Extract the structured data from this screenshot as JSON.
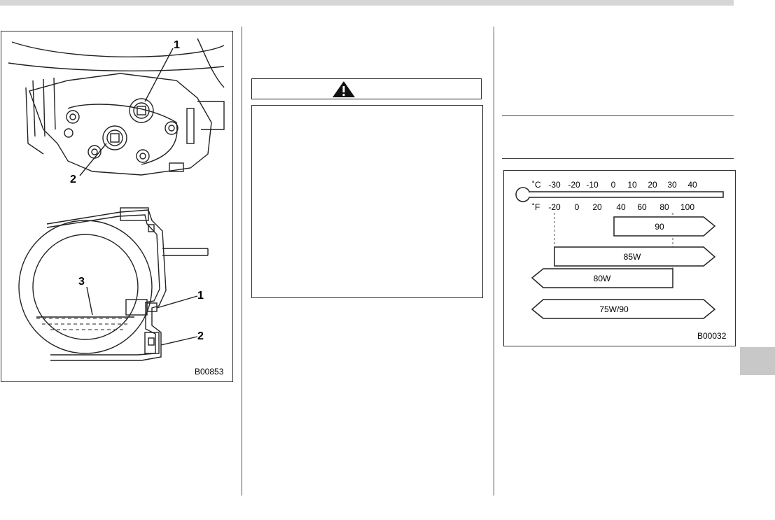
{
  "figure_left": {
    "code": "B00853",
    "callouts_top": [
      "1",
      "2"
    ],
    "callouts_bottom": [
      "3",
      "1",
      "2"
    ]
  },
  "figure_right": {
    "code": "B00032",
    "celsius_unit": "˚C",
    "fahrenheit_unit": "˚F",
    "celsius_ticks": [
      "-30",
      "-20",
      "-10",
      "0",
      "10",
      "20",
      "30",
      "40"
    ],
    "fahrenheit_ticks": [
      "-20",
      "0",
      "20",
      "40",
      "60",
      "80",
      "100"
    ],
    "grades": [
      "90",
      "85W",
      "80W",
      "75W/90"
    ]
  },
  "colors": {
    "line": "#222222",
    "side_tab": "#c8c8c8",
    "top_bar": "#d6d6d6"
  }
}
